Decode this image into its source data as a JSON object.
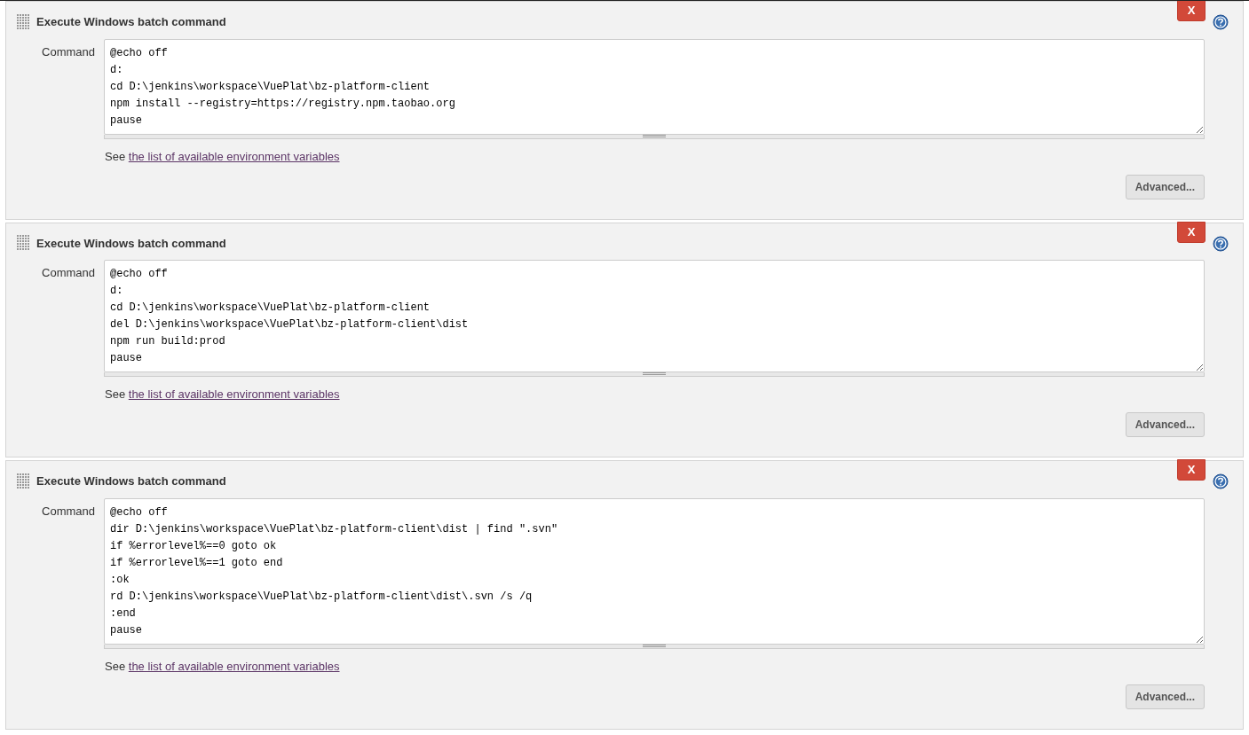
{
  "build_steps": [
    {
      "title": "Execute Windows batch command",
      "close_label": "X",
      "field_label": "Command",
      "command": "@echo off\nd:\ncd D:\\jenkins\\workspace\\VuePlat\\bz-platform-client\nnpm install --registry=https://registry.npm.taobao.org\npause",
      "help_prefix": "See",
      "help_link": "the list of available environment variables",
      "advanced_label": "Advanced..."
    },
    {
      "title": "Execute Windows batch command",
      "close_label": "X",
      "field_label": "Command",
      "command": "@echo off\nd:\ncd D:\\jenkins\\workspace\\VuePlat\\bz-platform-client\ndel D:\\jenkins\\workspace\\VuePlat\\bz-platform-client\\dist\nnpm run build:prod\npause",
      "help_prefix": "See",
      "help_link": "the list of available environment variables",
      "advanced_label": "Advanced..."
    },
    {
      "title": "Execute Windows batch command",
      "close_label": "X",
      "field_label": "Command",
      "command": "@echo off\ndir D:\\jenkins\\workspace\\VuePlat\\bz-platform-client\\dist | find \".svn\"\nif %errorlevel%==0 goto ok\nif %errorlevel%==1 goto end\n:ok\nrd D:\\jenkins\\workspace\\VuePlat\\bz-platform-client\\dist\\.svn /s /q\n:end\npause",
      "help_prefix": "See",
      "help_link": "the list of available environment variables",
      "advanced_label": "Advanced..."
    }
  ]
}
